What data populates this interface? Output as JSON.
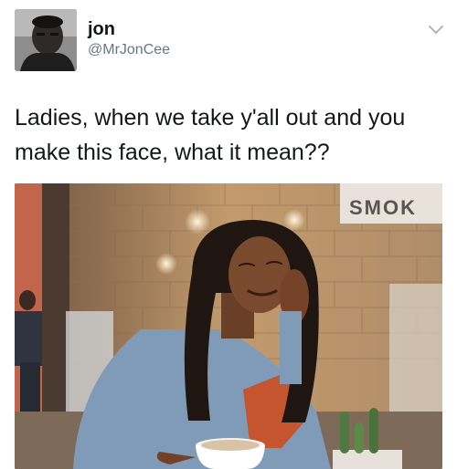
{
  "tweet": {
    "author": {
      "name": "jon",
      "handle": "@MrJonCee"
    },
    "text": "Ladies, when we take y'all out and you\nmake this face, what it mean??",
    "media": {
      "sign_text": "SMOK"
    },
    "icons": {
      "avatar": "avatar-photo",
      "menu": "chevron-down-icon"
    },
    "colors": {
      "text": "#14171a",
      "secondary": "#657786",
      "caret": "#aab8c2"
    }
  }
}
